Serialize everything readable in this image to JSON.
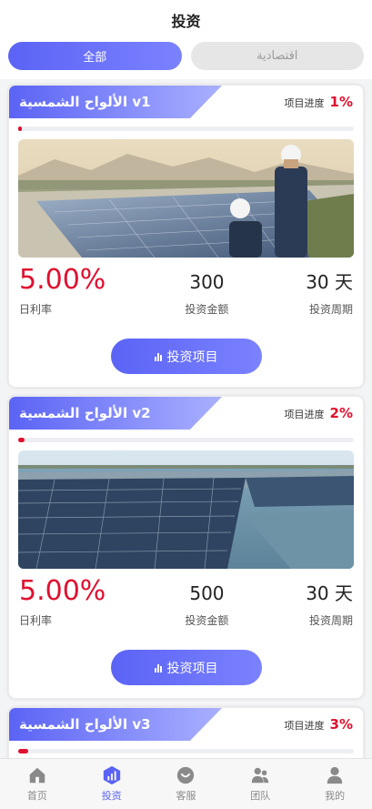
{
  "header": {
    "title": "投资"
  },
  "tabs": [
    {
      "label": "全部",
      "active": true
    },
    {
      "label": "اقتصادية",
      "active": false
    }
  ],
  "cards": [
    {
      "title": "الألواح الشمسية v1",
      "progress_label": "项目进度",
      "progress_value": "1%",
      "progress_fraction": 0.012,
      "photo_icon": "solar-farm-engineers-photo",
      "rate": "5.00%",
      "amount": "300",
      "period": "30 天",
      "rate_label": "日利率",
      "amount_label": "投资金额",
      "period_label": "投资周期",
      "button_label": "投资项目"
    },
    {
      "title": "الألواح الشمسية v2",
      "progress_label": "项目进度",
      "progress_value": "2%",
      "progress_fraction": 0.02,
      "photo_icon": "floating-solar-farm-photo",
      "rate": "5.00%",
      "amount": "500",
      "period": "30 天",
      "rate_label": "日利率",
      "amount_label": "投资金额",
      "period_label": "投资周期",
      "button_label": "投资项目"
    },
    {
      "title": "الألواح الشمسية v3",
      "progress_label": "项目进度",
      "progress_value": "3%",
      "progress_fraction": 0.03
    }
  ],
  "tabbar": [
    {
      "label": "首页",
      "icon": "home-icon",
      "active": false
    },
    {
      "label": "投资",
      "icon": "invest-icon",
      "active": true
    },
    {
      "label": "客服",
      "icon": "service-icon",
      "active": false
    },
    {
      "label": "团队",
      "icon": "team-icon",
      "active": false
    },
    {
      "label": "我的",
      "icon": "profile-icon",
      "active": false
    }
  ],
  "colors": {
    "accent": "#5b63f5",
    "highlight": "#e0102f"
  }
}
